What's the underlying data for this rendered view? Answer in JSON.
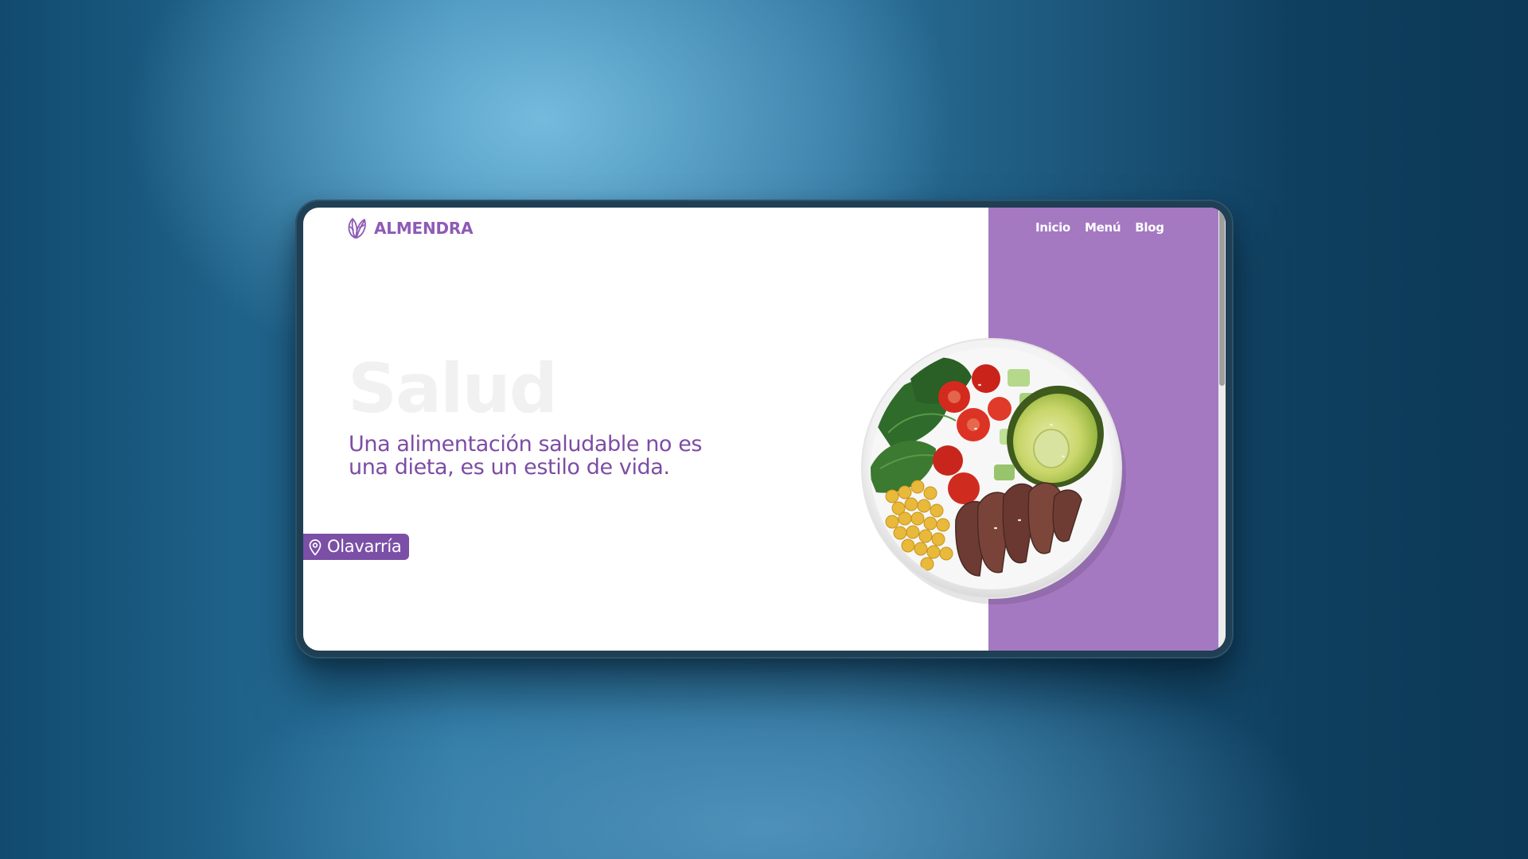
{
  "site": {
    "brand": "ALMENDRA",
    "nav": [
      {
        "label": "Inicio"
      },
      {
        "label": "Menú"
      },
      {
        "label": "Blog"
      }
    ]
  },
  "hero": {
    "title": "Salud",
    "subtitle": "Una alimentación saludable no es una dieta, es un estilo de vida.",
    "location": "Olavarría"
  },
  "colors": {
    "brand_purple": "#8e5bb5",
    "panel_purple": "#a479c2",
    "badge_purple": "#7b4fa6",
    "title_ghost": "#f1f1f1",
    "subtitle_purple": "#7d4ca4"
  },
  "icons": {
    "logo": "almond-leaf-icon",
    "location": "map-pin-icon"
  }
}
